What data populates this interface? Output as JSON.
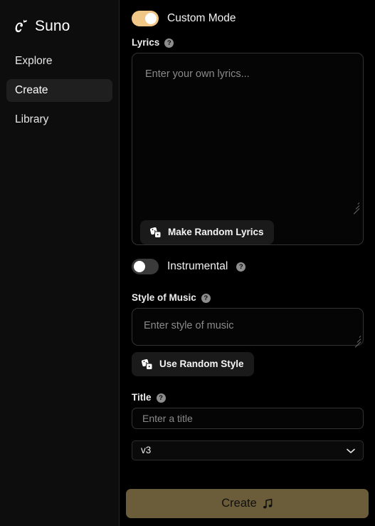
{
  "brand": {
    "name": "Suno",
    "logo_icon": "suno-wave-logo"
  },
  "sidebar": {
    "items": [
      {
        "label": "Explore",
        "active": false
      },
      {
        "label": "Create",
        "active": true
      },
      {
        "label": "Library",
        "active": false
      }
    ]
  },
  "main": {
    "custom_mode": {
      "label": "Custom Mode",
      "state": "on",
      "track_color": "#f0c786",
      "knob_color": "#ffffff"
    },
    "lyrics": {
      "label": "Lyrics",
      "help_icon": "help-circle-icon",
      "help_glyph": "?",
      "placeholder": "Enter your own lyrics...",
      "value": "",
      "random_button": {
        "label": "Make Random Lyrics",
        "icon": "dice-icon"
      }
    },
    "instrumental": {
      "label": "Instrumental",
      "state": "off",
      "track_color": "#3a3a3a",
      "knob_color": "#ffffff",
      "help_icon": "help-circle-icon",
      "help_glyph": "?"
    },
    "style_of_music": {
      "label": "Style of Music",
      "help_icon": "help-circle-icon",
      "help_glyph": "?",
      "placeholder": "Enter style of music",
      "value": "",
      "random_button": {
        "label": "Use Random Style",
        "icon": "dice-icon"
      }
    },
    "title": {
      "label": "Title",
      "help_icon": "help-circle-icon",
      "help_glyph": "?",
      "placeholder": "Enter a title",
      "value": ""
    },
    "version": {
      "selected": "v3",
      "chevron_icon": "chevron-down-icon"
    },
    "create_button": {
      "label": "Create",
      "icon": "music-note-icon",
      "color": "#6b5c3a",
      "text_color": "#101010"
    }
  }
}
